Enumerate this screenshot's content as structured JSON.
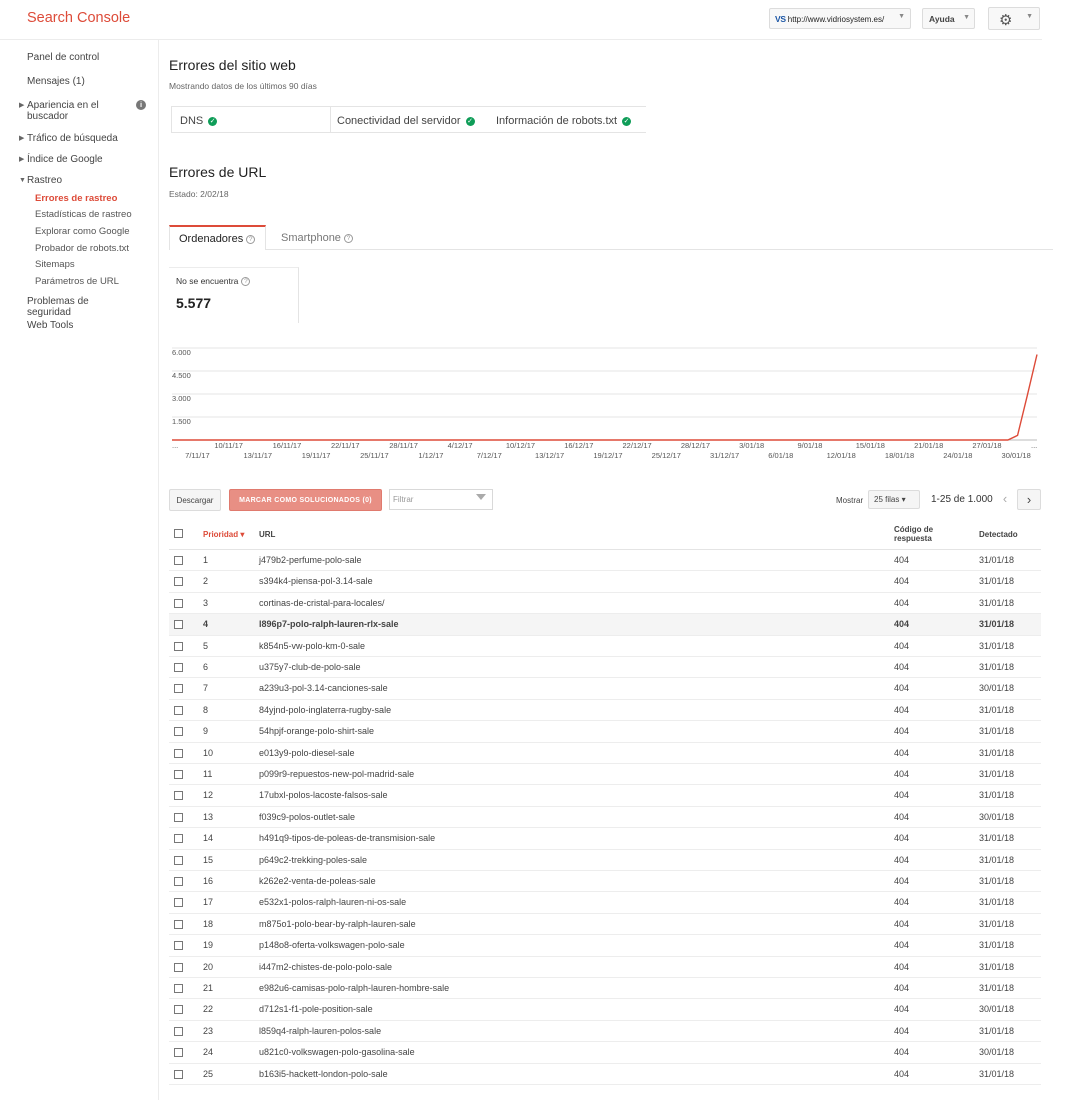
{
  "app": {
    "title": "Search Console",
    "site_prefix": "VS",
    "site_url": "http://www.vidriosystem.es/",
    "help_label": "Ayuda"
  },
  "sidebar": {
    "panel": "Panel de control",
    "messages": "Mensajes (1)",
    "appearance": "Apariencia en el buscador",
    "traffic": "Tráfico de búsqueda",
    "index": "Índice de Google",
    "crawl": "Rastreo",
    "crawl_items": [
      "Errores de rastreo",
      "Estadísticas de rastreo",
      "Explorar como Google",
      "Probador de robots.txt",
      "Sitemaps",
      "Parámetros de URL"
    ],
    "security": "Problemas de seguridad",
    "webtools": "Web Tools"
  },
  "site_errors": {
    "title": "Errores del sitio web",
    "subtitle": "Mostrando datos de los últimos 90 días",
    "dns": "DNS",
    "connectivity": "Conectividad del servidor",
    "robots": "Información de robots.txt"
  },
  "url_errors": {
    "title": "Errores de URL",
    "status": "Estado: 2/02/18",
    "tab_desktop": "Ordenadores",
    "tab_smartphone": "Smartphone",
    "metric_label": "No se encuentra",
    "metric_value": "5.577"
  },
  "chart_data": {
    "type": "line",
    "y_ticks": [
      "6.000",
      "4.500",
      "3.000",
      "1.500"
    ],
    "ylim": [
      0,
      6000
    ],
    "x_labels_top": [
      "...",
      "10/11/17",
      "16/11/17",
      "22/11/17",
      "28/11/17",
      "4/12/17",
      "10/12/17",
      "16/12/17",
      "22/12/17",
      "28/12/17",
      "3/01/18",
      "9/01/18",
      "15/01/18",
      "21/01/18",
      "27/01/18",
      "..."
    ],
    "x_labels_bottom": [
      "7/11/17",
      "13/11/17",
      "19/11/17",
      "25/11/17",
      "1/12/17",
      "7/12/17",
      "13/12/17",
      "19/12/17",
      "25/12/17",
      "31/12/17",
      "6/01/18",
      "12/01/18",
      "18/01/18",
      "24/01/18",
      "30/01/18"
    ],
    "series": [
      {
        "color": "#dd4b39",
        "x": [
          "4/11/17",
          "29/01/18",
          "30/01/18",
          "31/01/18",
          "1/02/18"
        ],
        "values": [
          0,
          0,
          300,
          2900,
          5577
        ]
      }
    ]
  },
  "toolbar": {
    "download": "Descargar",
    "mark_fixed": "MARCAR COMO SOLUCIONADOS (0)",
    "filter_placeholder": "Filtrar",
    "show": "Mostrar",
    "rows": "25 filas",
    "range": "1-25 de 1.000"
  },
  "table": {
    "headers": {
      "priority": "Prioridad",
      "url": "URL",
      "code": "Código de respuesta",
      "detected": "Detectado"
    },
    "rows": [
      {
        "priority": "1",
        "url": "j479b2-perfume-polo-sale",
        "code": "404",
        "detected": "31/01/18"
      },
      {
        "priority": "2",
        "url": "s394k4-piensa-pol-3.14-sale",
        "code": "404",
        "detected": "31/01/18"
      },
      {
        "priority": "3",
        "url": "cortinas-de-cristal-para-locales/",
        "code": "404",
        "detected": "31/01/18"
      },
      {
        "priority": "4",
        "url": "l896p7-polo-ralph-lauren-rlx-sale",
        "code": "404",
        "detected": "31/01/18"
      },
      {
        "priority": "5",
        "url": "k854n5-vw-polo-km-0-sale",
        "code": "404",
        "detected": "31/01/18"
      },
      {
        "priority": "6",
        "url": "u375y7-club-de-polo-sale",
        "code": "404",
        "detected": "31/01/18"
      },
      {
        "priority": "7",
        "url": "a239u3-pol-3.14-canciones-sale",
        "code": "404",
        "detected": "30/01/18"
      },
      {
        "priority": "8",
        "url": "84yjnd-polo-inglaterra-rugby-sale",
        "code": "404",
        "detected": "31/01/18"
      },
      {
        "priority": "9",
        "url": "54hpjf-orange-polo-shirt-sale",
        "code": "404",
        "detected": "31/01/18"
      },
      {
        "priority": "10",
        "url": "e013y9-polo-diesel-sale",
        "code": "404",
        "detected": "31/01/18"
      },
      {
        "priority": "11",
        "url": "p099r9-repuestos-new-pol-madrid-sale",
        "code": "404",
        "detected": "31/01/18"
      },
      {
        "priority": "12",
        "url": "17ubxl-polos-lacoste-falsos-sale",
        "code": "404",
        "detected": "31/01/18"
      },
      {
        "priority": "13",
        "url": "f039c9-polos-outlet-sale",
        "code": "404",
        "detected": "30/01/18"
      },
      {
        "priority": "14",
        "url": "h491q9-tipos-de-poleas-de-transmision-sale",
        "code": "404",
        "detected": "31/01/18"
      },
      {
        "priority": "15",
        "url": "p649c2-trekking-poles-sale",
        "code": "404",
        "detected": "31/01/18"
      },
      {
        "priority": "16",
        "url": "k262e2-venta-de-poleas-sale",
        "code": "404",
        "detected": "31/01/18"
      },
      {
        "priority": "17",
        "url": "e532x1-polos-ralph-lauren-ni-os-sale",
        "code": "404",
        "detected": "31/01/18"
      },
      {
        "priority": "18",
        "url": "m875o1-polo-bear-by-ralph-lauren-sale",
        "code": "404",
        "detected": "31/01/18"
      },
      {
        "priority": "19",
        "url": "p148o8-oferta-volkswagen-polo-sale",
        "code": "404",
        "detected": "31/01/18"
      },
      {
        "priority": "20",
        "url": "i447m2-chistes-de-polo-polo-sale",
        "code": "404",
        "detected": "31/01/18"
      },
      {
        "priority": "21",
        "url": "e982u6-camisas-polo-ralph-lauren-hombre-sale",
        "code": "404",
        "detected": "31/01/18"
      },
      {
        "priority": "22",
        "url": "d712s1-f1-pole-position-sale",
        "code": "404",
        "detected": "30/01/18"
      },
      {
        "priority": "23",
        "url": "l859q4-ralph-lauren-polos-sale",
        "code": "404",
        "detected": "31/01/18"
      },
      {
        "priority": "24",
        "url": "u821c0-volkswagen-polo-gasolina-sale",
        "code": "404",
        "detected": "30/01/18"
      },
      {
        "priority": "25",
        "url": "b163i5-hackett-london-polo-sale",
        "code": "404",
        "detected": "31/01/18"
      }
    ]
  }
}
